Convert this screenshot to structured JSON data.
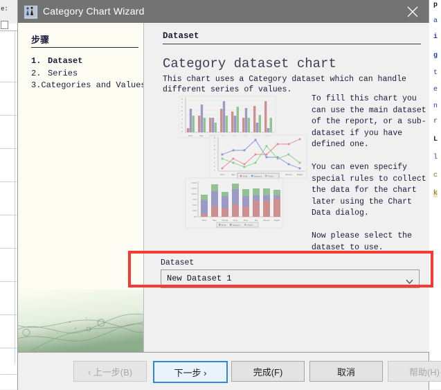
{
  "window": {
    "title": "Category Chart Wizard",
    "icon": "app-chart-wizard-icon",
    "close_label": "✕"
  },
  "sidebar": {
    "title": "步骤",
    "steps": [
      {
        "number": "1.",
        "label": "Dataset",
        "current": true
      },
      {
        "number": "2.",
        "label": "Series",
        "current": false
      },
      {
        "number": "3.",
        "label": "Categories and Values",
        "current": false
      }
    ]
  },
  "content": {
    "section_title": "Dataset",
    "heading": "Category dataset chart",
    "subtext": "This chart uses a Category dataset which can handle different series of values.",
    "side_copy": "To fill this chart you can use the main dataset of the report, or a sub-dataset if you have defined one.\n\nYou can even specify special rules to collect the data for the chart later using the Chart Data dialog.\n\nNow please select the dataset to use.",
    "dataset_group": {
      "label": "Dataset",
      "selected": "New Dataset 1",
      "arrow_icon": "chevron-down-icon"
    },
    "highlight_color": "#fa3a32"
  },
  "preview": {
    "legend": [
      "First",
      "Second",
      "Third"
    ],
    "categories": [
      "One",
      "Two",
      "Three",
      "Four",
      "Five",
      "Six",
      "Seven",
      "Eight"
    ],
    "colors": {
      "first": "#c06a6a",
      "second": "#7a7ab5",
      "third": "#72b072"
    }
  },
  "buttons": [
    {
      "name": "back",
      "label": "‹ 上一步(B)",
      "mnemonic": "B",
      "state": "disabled"
    },
    {
      "name": "next",
      "label": "下一步 ›",
      "mnemonic": "",
      "state": "focused"
    },
    {
      "name": "finish",
      "label": "完成(F)",
      "mnemonic": "F",
      "state": "normal"
    },
    {
      "name": "cancel",
      "label": "取消",
      "mnemonic": "",
      "state": "normal"
    },
    {
      "name": "help",
      "label": "帮助(H)",
      "mnemonic": "H",
      "state": "disabled"
    }
  ],
  "background": {
    "left_header_text": "e:",
    "code_fragment": [
      "p",
      "a",
      "i",
      "g",
      "t",
      "e",
      "n",
      "r",
      "L",
      "l",
      "c"
    ]
  },
  "chart_data": [
    {
      "type": "bar",
      "title": "",
      "categories": [
        "One",
        "Two",
        "Three",
        "Four",
        "Five",
        "Six",
        "Seven",
        "Eight"
      ],
      "series": [
        {
          "name": "First",
          "values": [
            1,
            4,
            3,
            6,
            5,
            3,
            7,
            8
          ]
        },
        {
          "name": "Second",
          "values": [
            6,
            7,
            3,
            8,
            4,
            6,
            2,
            1
          ]
        },
        {
          "name": "Third",
          "values": [
            4,
            3,
            2,
            4,
            7,
            3,
            4,
            3
          ]
        }
      ],
      "ylim": [
        0,
        9
      ],
      "grid": true,
      "legend": "none"
    },
    {
      "type": "line",
      "title": "",
      "categories": [
        "One",
        "Two",
        "Three",
        "Four",
        "Five",
        "Six",
        "Seven",
        "Eight"
      ],
      "series": [
        {
          "name": "First",
          "values": [
            1,
            4,
            2,
            5,
            5,
            7,
            7,
            8
          ]
        },
        {
          "name": "Second",
          "values": [
            5,
            6,
            6,
            8,
            4,
            4,
            2,
            1
          ]
        },
        {
          "name": "Third",
          "values": [
            4,
            3,
            2,
            3,
            6,
            3,
            4,
            2
          ]
        }
      ],
      "ylim": [
        0,
        8
      ],
      "grid": false,
      "legend": "bottom-inside"
    },
    {
      "type": "bar",
      "title": "",
      "stacked": true,
      "categories": [
        "One",
        "Two",
        "Three",
        "Four",
        "Five",
        "Six",
        "Seven",
        "Eight"
      ],
      "series": [
        {
          "name": "First",
          "values": [
            10,
            40,
            30,
            55,
            45,
            70,
            70,
            80
          ]
        },
        {
          "name": "Second",
          "values": [
            65,
            70,
            60,
            70,
            45,
            25,
            25,
            15
          ]
        },
        {
          "name": "Third",
          "values": [
            25,
            40,
            20,
            30,
            35,
            30,
            30,
            25
          ]
        }
      ],
      "ylim": [
        0,
        150
      ],
      "yticks": [
        "0.0",
        "25.0",
        "50.0",
        "75.0",
        "100.0",
        "125.0",
        "150.0"
      ],
      "grid": false,
      "legend": "bottom"
    }
  ]
}
